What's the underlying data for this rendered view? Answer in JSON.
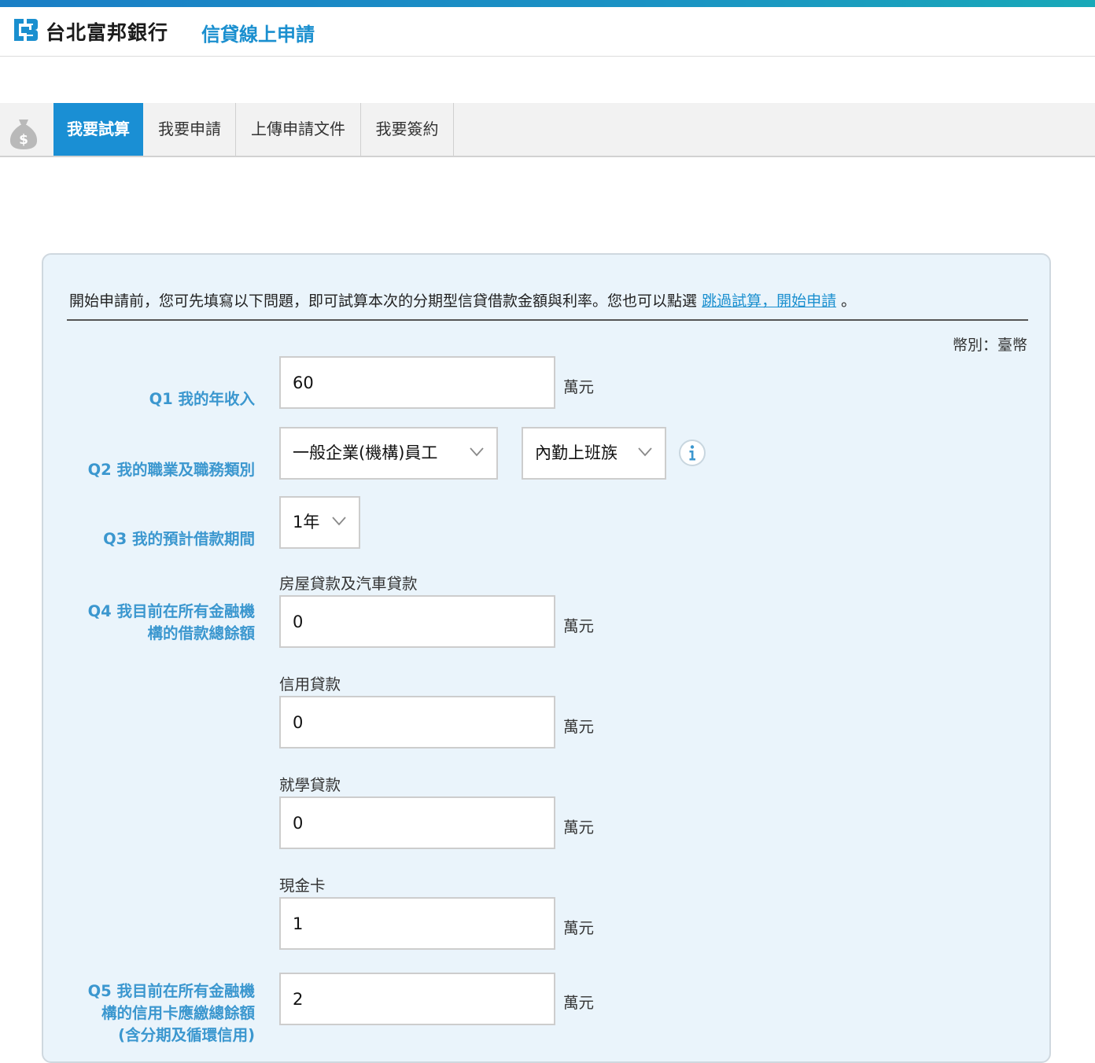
{
  "header": {
    "bank_name": "台北富邦銀行",
    "service_name": "信貸線上申請",
    "brand_color": "#1a8fcf"
  },
  "nav": {
    "icon": "money-bag-icon",
    "tabs": [
      {
        "label": "我要試算",
        "active": true
      },
      {
        "label": "我要申請",
        "active": false
      },
      {
        "label": "上傳申請文件",
        "active": false
      },
      {
        "label": "我要簽約",
        "active": false
      }
    ]
  },
  "intro": {
    "text_before": "開始申請前，您可先填寫以下問題，即可試算本次的分期型信貸借款金額與利率。您也可以點選",
    "link_text": "跳過試算，開始申請",
    "text_after": "。"
  },
  "currency_label": "幣別：臺幣",
  "unit": "萬元",
  "q1": {
    "label": "Q1 我的年收入",
    "value": "60"
  },
  "q2": {
    "label": "Q2 我的職業及職務類別",
    "occupation": "一般企業(機構)員工",
    "job_type": "內勤上班族",
    "info_icon": "info-icon"
  },
  "q3": {
    "label": "Q3 我的預計借款期間",
    "period": "1年"
  },
  "q4": {
    "label_line1": "Q4 我目前在所有金融機",
    "label_line2": "構的借款總餘額",
    "items": [
      {
        "label": "房屋貸款及汽車貸款",
        "value": "0"
      },
      {
        "label": "信用貸款",
        "value": "0"
      },
      {
        "label": "就學貸款",
        "value": "0"
      },
      {
        "label": "現金卡",
        "value": "1"
      }
    ]
  },
  "q5": {
    "label_line1": "Q5 我目前在所有金融機",
    "label_line2": "構的信用卡應繳總餘額",
    "label_line3": "(含分期及循環信用)",
    "value": "2"
  }
}
